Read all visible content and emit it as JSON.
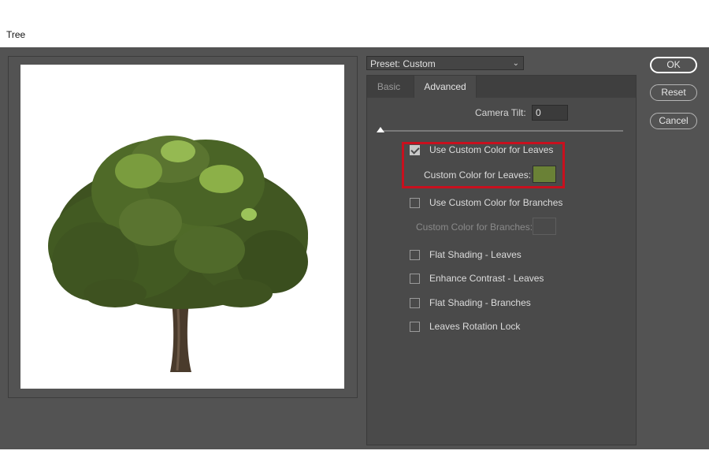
{
  "window": {
    "title": "Tree"
  },
  "preset": {
    "label": "Preset: Custom"
  },
  "tabs": [
    {
      "label": "Basic",
      "active": false
    },
    {
      "label": "Advanced",
      "active": true
    }
  ],
  "camera_tilt": {
    "label": "Camera Tilt:",
    "value": "0"
  },
  "options": {
    "leaves_color_toggle": {
      "label": "Use Custom Color for Leaves",
      "checked": true
    },
    "leaves_color": {
      "label": "Custom Color for Leaves:",
      "color": "#6a8136"
    },
    "branches_color_toggle": {
      "label": "Use Custom Color for Branches",
      "checked": false
    },
    "branches_color": {
      "label": "Custom Color for Branches:",
      "disabled": true
    },
    "flat_shading_leaves": {
      "label": "Flat Shading - Leaves",
      "checked": false
    },
    "enhance_contrast_leaves": {
      "label": "Enhance Contrast - Leaves",
      "checked": false
    },
    "flat_shading_branches": {
      "label": "Flat Shading - Branches",
      "checked": false
    },
    "leaves_rotation_lock": {
      "label": "Leaves Rotation Lock",
      "checked": false
    }
  },
  "buttons": {
    "ok": "OK",
    "reset": "Reset",
    "cancel": "Cancel"
  },
  "colors": {
    "dialog_bg": "#535353",
    "highlight": "#c8101e",
    "leaf_dark": "#3e5220",
    "leaf_mid": "#5a7430",
    "leaf_light": "#8cb048",
    "trunk": "#4a3b2c"
  }
}
